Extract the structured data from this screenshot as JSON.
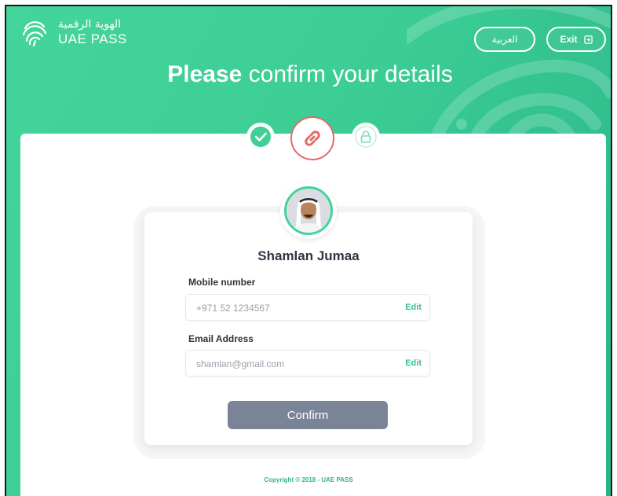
{
  "brand": {
    "arabic_name": "الهوية الرقمية",
    "english_name": "UAE PASS"
  },
  "header": {
    "language_button": "العربية",
    "exit_button": "Exit"
  },
  "title": {
    "bold": "Please",
    "rest": " confirm your details"
  },
  "steps": [
    {
      "name": "verified",
      "icon": "check-icon",
      "status": "done"
    },
    {
      "name": "link",
      "icon": "link-icon",
      "status": "active"
    },
    {
      "name": "lock",
      "icon": "lock-icon",
      "status": "pending"
    }
  ],
  "profile": {
    "name": "Shamlan Jumaa"
  },
  "fields": {
    "mobile": {
      "label": "Mobile number",
      "value": "+971 52 1234567",
      "edit": "Edit"
    },
    "email": {
      "label": "Email Address",
      "value": "shamlan@gmail.com",
      "edit": "Edit"
    }
  },
  "actions": {
    "confirm": "Confirm"
  },
  "footer": {
    "copyright": "Copyright © 2018 - UAE PASS"
  },
  "colors": {
    "brand_green": "#3ccd95",
    "active_step": "#e26b68",
    "confirm_button": "#7b8497",
    "edit_link": "#36c28c"
  }
}
